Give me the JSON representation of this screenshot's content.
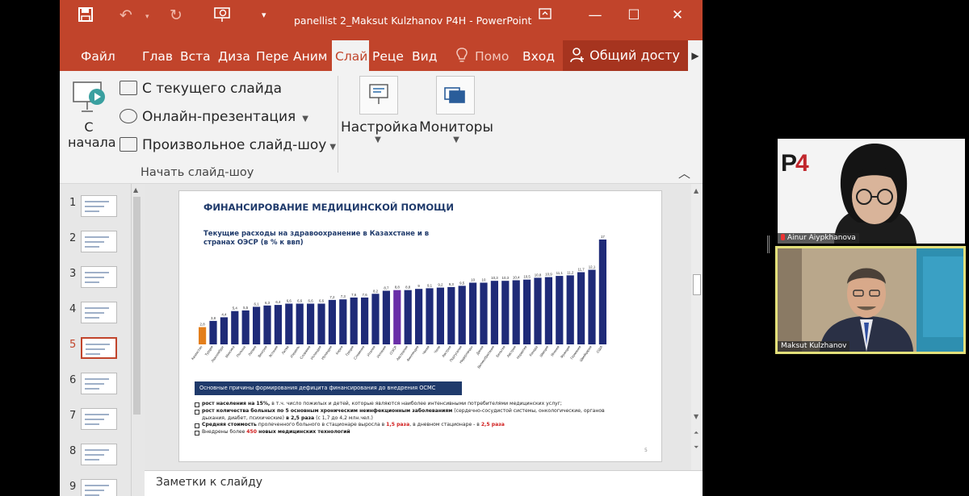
{
  "window": {
    "title": "panellist 2_Maksut Kulzhanov P4H  -  PowerPoint",
    "quick_access": [
      "save-icon",
      "undo-icon",
      "redo-icon",
      "present-from-start-icon",
      "customize-icon"
    ]
  },
  "tabs": [
    {
      "label": "Файл",
      "active": false
    },
    {
      "label": "Глав",
      "active": false
    },
    {
      "label": "Вста",
      "active": false
    },
    {
      "label": "Диза",
      "active": false
    },
    {
      "label": "Пере",
      "active": false
    },
    {
      "label": "Аним",
      "active": false
    },
    {
      "label": "Слай",
      "active": true
    },
    {
      "label": "Реце",
      "active": false
    },
    {
      "label": "Вид",
      "active": false
    },
    {
      "label": "Помо",
      "active": false
    },
    {
      "label": "Вход",
      "active": false
    }
  ],
  "share_label": "Общий досту",
  "ribbon": {
    "from_start_line1": "С",
    "from_start_line2": "начала",
    "from_current": "С текущего слайда",
    "online": "Онлайн-презентация",
    "custom": "Произвольное слайд-шоу",
    "group_label": "Начать слайд-шоу",
    "setup_label": "Настройка",
    "monitors_label": "Мониторы"
  },
  "thumbnails": [
    "1",
    "2",
    "3",
    "4",
    "5",
    "6",
    "7",
    "8",
    "9"
  ],
  "active_slide": 5,
  "slide": {
    "title": "ФИНАНСИРОВАНИЕ МЕДИЦИНСКОЙ ПОМОЩИ",
    "subtitle": "Текущие расходы на здравоохранение в Казахстане и в странах ОЭСР (в % к ввп)",
    "reasons_header": "Основные причины формирования дефицита финансирования до внедрения ОСМС",
    "reason1_a": "рост населения на 15%,",
    "reason1_b": " в т.ч. число пожилых и детей, которые являются наиболее интенсивными потребителями медицинских услуг;",
    "reason2_a": "рост количества больных по 5 основным хроническим неинфекционным заболеваниям",
    "reason2_b": " (сердечно-сосудистой системы, онкологические, органов",
    "reason2_c": "дыхания, диабет, психические)",
    "reason2_d": " в 2,5 раза",
    "reason2_e": " (с 1,7  до 4,2 млн.чел.)",
    "reason3_a": "Средняя стоимость",
    "reason3_b": " пролеченного больного в стационаре выросла в ",
    "reason3_c": "1,5 раза",
    "reason3_d": ", в дневном стационаре - в ",
    "reason3_e": "2,5 раза",
    "reason4_a": "Внедрены более ",
    "reason4_b": "450",
    "reason4_c": " новых медицинских технологий",
    "page_number": "5"
  },
  "chart_data": {
    "type": "bar",
    "categories": [
      "Казахстан",
      "Турция",
      "Люксембург",
      "Мексика",
      "Польша",
      "Латвия",
      "Венгрия",
      "Эстония",
      "Литва",
      "Израиль",
      "Словакия",
      "Исландия",
      "Ирландия",
      "Корея",
      "Греция",
      "Словения",
      "Италия",
      "Испания",
      "ОЭСР",
      "Австралия",
      "Финляндия",
      "Чехия",
      "Чили",
      "Австрия",
      "Португалия",
      "Нидерланды",
      "Дания",
      "Великобритания",
      "Бельгия",
      "Австрия",
      "Норвегия",
      "Канада",
      "Швеция",
      "Япония",
      "Франция",
      "Германия",
      "Швейцария",
      "США"
    ],
    "values": [
      2.8,
      3.8,
      4.4,
      5.4,
      5.5,
      6.1,
      6.3,
      6.4,
      6.6,
      6.6,
      6.6,
      6.6,
      7.2,
      7.3,
      7.6,
      7.6,
      8.2,
      8.7,
      8.8,
      8.8,
      9,
      9.1,
      9.2,
      9.3,
      9.5,
      10,
      10,
      10.3,
      10.3,
      10.4,
      10.5,
      10.8,
      10.9,
      11.1,
      11.2,
      11.7,
      12.1,
      17
    ],
    "labels": [
      "2,8",
      "3,8",
      "4,4",
      "5,4",
      "5,5",
      "6,1",
      "6,3",
      "6,4",
      "6,6",
      "6,6",
      "6,6",
      "6,6",
      "7,2",
      "7,3",
      "7,6",
      "7,6",
      "8,2",
      "8,7",
      "8,8",
      "8,8",
      "9",
      "9,1",
      "9,2",
      "9,3",
      "9,5",
      "10",
      "10",
      "10,3",
      "10,3",
      "10,4",
      "10,5",
      "10,8",
      "10,9",
      "11,1",
      "11,2",
      "11,7",
      "12,1",
      "17"
    ],
    "highlight": {
      "0": "#e37f1c",
      "18": "#6a2fa8"
    },
    "bar_color": "#1f2b78",
    "ylim": [
      0,
      17
    ]
  },
  "notes_placeholder": "Заметки к слайду",
  "participants": [
    {
      "name": "Ainur Aiypkhanova",
      "muted": true
    },
    {
      "name": "Maksut Kulzhanov",
      "muted": false
    }
  ],
  "colors": {
    "accent": "#c1442b",
    "active_speaker": "#e3e07a"
  }
}
